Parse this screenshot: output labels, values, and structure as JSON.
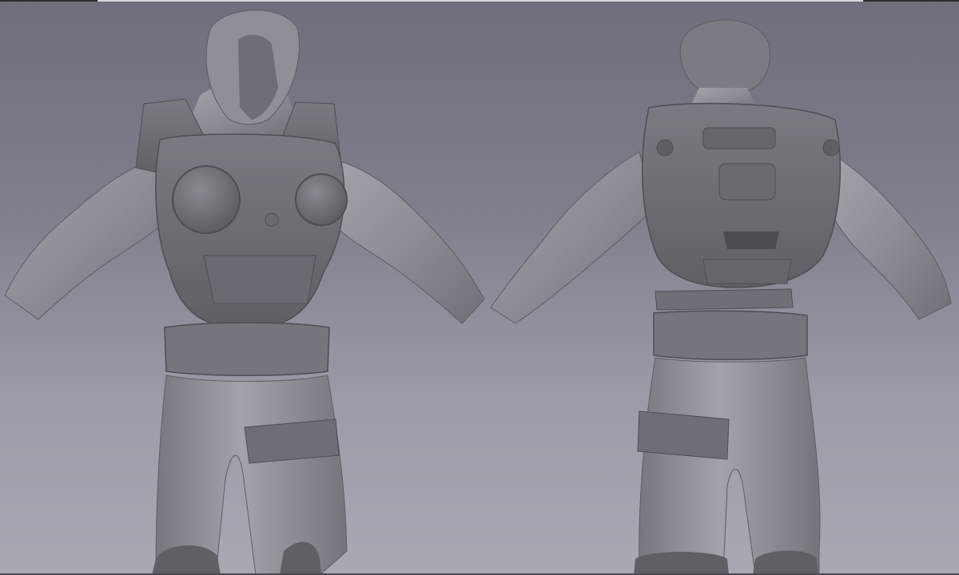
{
  "viewport": {
    "background_top": "#6d6f7b",
    "background_bottom": "#a7a9b3"
  },
  "models": [
    {
      "view": "front",
      "material_color": "#7d7e85"
    },
    {
      "view": "back",
      "material_color": "#7d7e85"
    }
  ]
}
